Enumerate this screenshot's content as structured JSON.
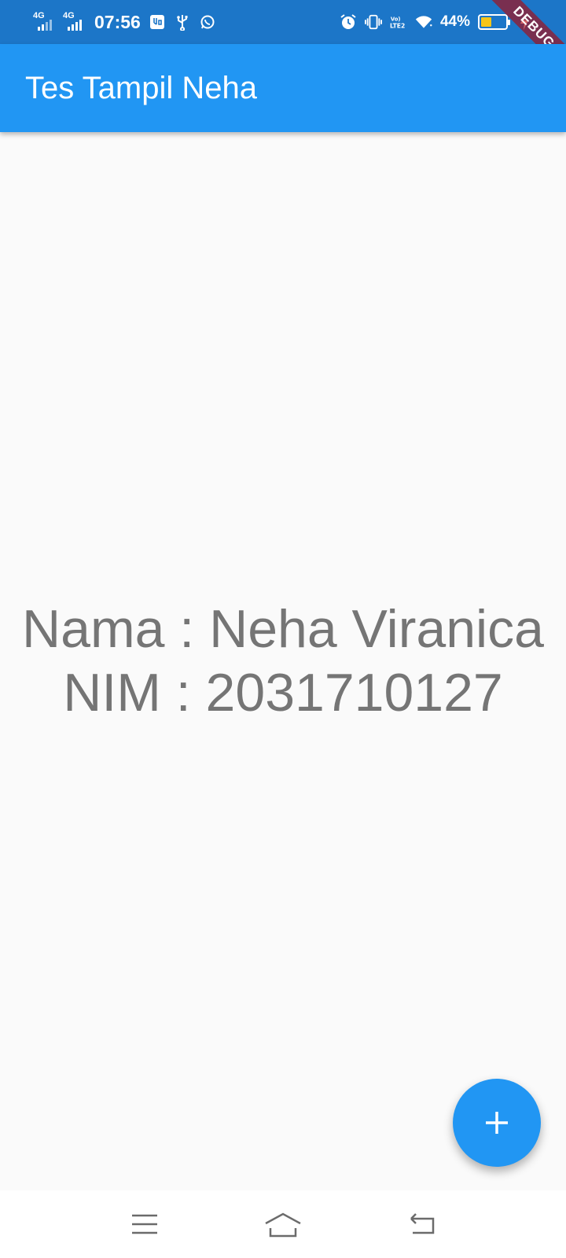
{
  "status_bar": {
    "network1_label": "4G",
    "network2_label": "4G",
    "time": "07:56",
    "battery_percent": "44%",
    "battery_level": 0.44,
    "icons": [
      "usb-mode-icon",
      "usb-icon",
      "whatsapp-icon",
      "alarm-icon",
      "vibrate-icon",
      "volte2-icon",
      "wifi-icon",
      "battery-icon",
      "charging-icon"
    ]
  },
  "debug_banner": "DEBUG",
  "app_bar": {
    "title": "Tes Tampil Neha"
  },
  "content": {
    "name_line": "Nama : Neha Viranica",
    "nim_line": "NIM : 2031710127"
  },
  "fab": {
    "icon": "plus-icon"
  },
  "nav_bar": {
    "icons": [
      "menu-icon",
      "home-icon",
      "back-icon"
    ]
  },
  "colors": {
    "primary": "#2196f3",
    "status_bar": "#1c76c8",
    "background": "#fafafa",
    "text": "#757575",
    "battery_fill": "#f5c518"
  }
}
